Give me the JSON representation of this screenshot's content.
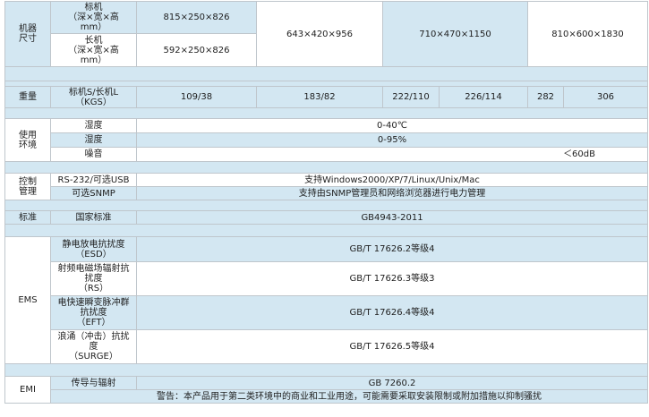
{
  "size": {
    "label": "机器\n尺寸",
    "standard_label": "标机\n（深×宽×高\nmm）",
    "long_label": "长机\n（深×宽×高\nmm）",
    "standard_value": "815×250×826",
    "long_value": "592×250×826",
    "values": [
      "643×420×956",
      "710×470×1150",
      "810×600×1830"
    ]
  },
  "weight": {
    "label": "重量",
    "sublabel": "标机S/长机L\n（KGS）",
    "values": [
      "109/38",
      "183/82",
      "222/110",
      "226/114",
      "282",
      "306"
    ]
  },
  "environment": {
    "label": "使用\n环境",
    "rows": [
      {
        "label": "湿度",
        "value": "0-40℃"
      },
      {
        "label": "湿度",
        "value": "0-95%"
      },
      {
        "label": "噪音",
        "value": "＜60dB"
      }
    ]
  },
  "control": {
    "label": "控制\n管理",
    "rows": [
      {
        "label": "RS-232/可选USB",
        "value": "支持Windows2000/XP/7/Linux/Unix/Mac"
      },
      {
        "label": "可选SNMP",
        "value": "支持由SNMP管理员和网络浏览器进行电力管理"
      }
    ]
  },
  "standard": {
    "label": "标准",
    "sublabel": "国家标准",
    "value": "GB4943-2011"
  },
  "ems": {
    "label": "EMS",
    "rows": [
      {
        "label": "静电放电抗扰度\n（ESD）",
        "value": "GB/T 17626.2等级4"
      },
      {
        "label": "射频电磁场辐射抗\n扰度\n（RS）",
        "value": "GB/T 17626.3等级3"
      },
      {
        "label": "电快速瞬变脉冲群\n抗扰度\n（EFT）",
        "value": "GB/T 17626.4等级4"
      },
      {
        "label": "浪涌（冲击）抗扰\n度\n（SURGE）",
        "value": "GB/T 17626.5等级4"
      }
    ]
  },
  "emi": {
    "label": "EMI",
    "sublabel": "传导与辐射",
    "value": "GB 7260.2",
    "warning": "警告：本产品用于第二类环境中的商业和工业用途，可能需要采取安装限制或附加措施以抑制骚扰"
  }
}
